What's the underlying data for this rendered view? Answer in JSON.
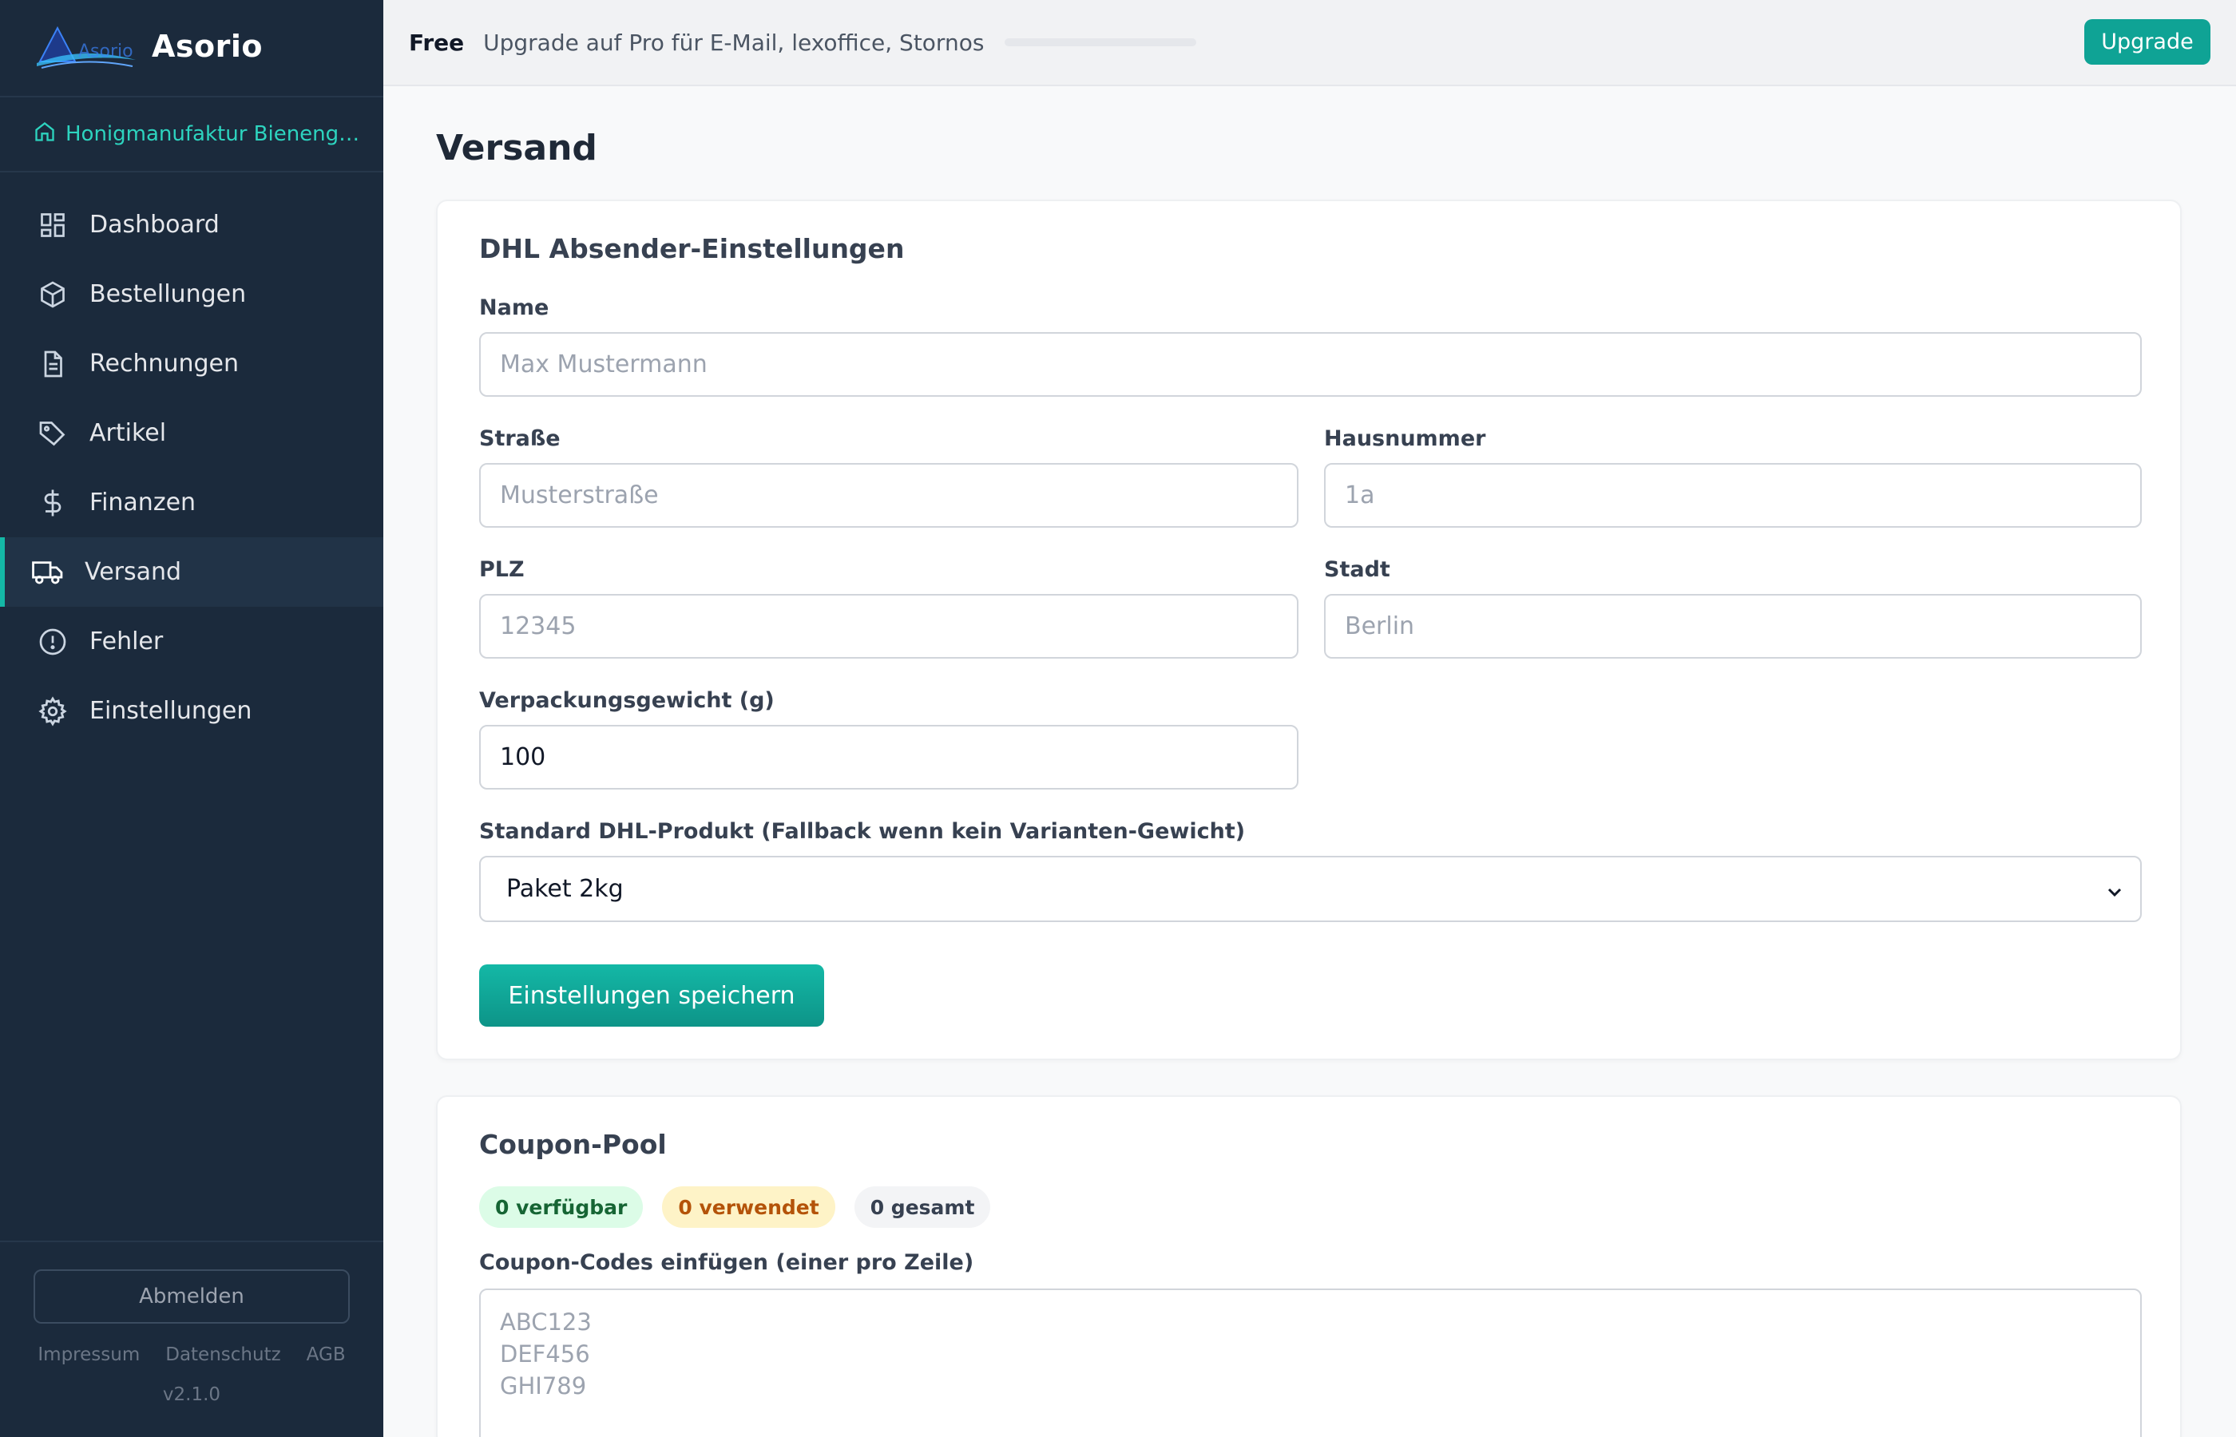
{
  "app": {
    "name": "Asorio",
    "logo_text": "Asorio",
    "store_name": "Honigmanufaktur Bienenglück"
  },
  "sidebar": {
    "items": [
      {
        "label": "Dashboard",
        "icon": "grid-icon"
      },
      {
        "label": "Bestellungen",
        "icon": "box-icon"
      },
      {
        "label": "Rechnungen",
        "icon": "document-icon"
      },
      {
        "label": "Artikel",
        "icon": "tag-icon"
      },
      {
        "label": "Finanzen",
        "icon": "dollar-icon"
      },
      {
        "label": "Versand",
        "icon": "truck-icon",
        "active": true
      },
      {
        "label": "Fehler",
        "icon": "alert-circle-icon"
      },
      {
        "label": "Einstellungen",
        "icon": "gear-icon"
      }
    ],
    "logout_label": "Abmelden",
    "footer_links": [
      "Impressum",
      "Datenschutz",
      "AGB"
    ],
    "version": "v2.1.0"
  },
  "topbar": {
    "plan": "Free",
    "upsell_text": "Upgrade auf Pro für E-Mail, lexoffice, Stornos",
    "upgrade_label": "Upgrade"
  },
  "page": {
    "title": "Versand"
  },
  "dhl_settings": {
    "title": "DHL Absender-Einstellungen",
    "name_label": "Name",
    "name_placeholder": "Max Mustermann",
    "street_label": "Straße",
    "street_placeholder": "Musterstraße",
    "house_number_label": "Hausnummer",
    "house_number_placeholder": "1a",
    "zip_label": "PLZ",
    "zip_placeholder": "12345",
    "city_label": "Stadt",
    "city_placeholder": "Berlin",
    "weight_label": "Verpackungsgewicht (g)",
    "weight_value": "100",
    "product_label": "Standard DHL-Produkt (Fallback wenn kein Varianten-Gewicht)",
    "product_selected": "Paket 2kg",
    "save_label": "Einstellungen speichern"
  },
  "coupon_pool": {
    "title": "Coupon-Pool",
    "available": "0 verfügbar",
    "used": "0 verwendet",
    "total": "0 gesamt",
    "codes_label": "Coupon-Codes einfügen (einer pro Zeile)",
    "codes_placeholder": "ABC123\nDEF456\nGHI789"
  },
  "colors": {
    "sidebar_bg": "#1b2a3c",
    "accent": "#14b8a6",
    "upgrade_button": "#0fa395"
  }
}
